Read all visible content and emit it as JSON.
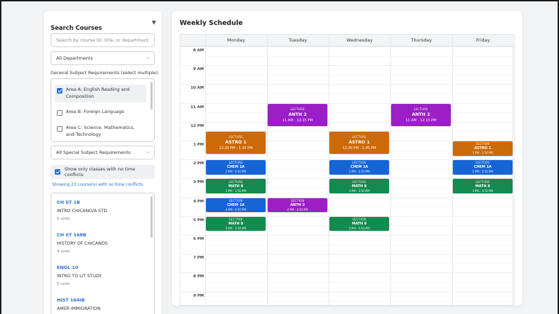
{
  "sidebar": {
    "title": "Search Courses",
    "search_placeholder": "Search by course ID, title, or department...",
    "department_select": "All Departments",
    "req_label": "General Subject Requirements (select multiple):",
    "requirements": [
      {
        "label": "Area A: English Reading and Composition",
        "checked": true
      },
      {
        "label": "Area B: Foreign Language",
        "checked": false
      },
      {
        "label": "Area C: Science, Mathematics, and Technology",
        "checked": false
      }
    ],
    "special_select": "All Special Subject Requirements",
    "no_conflict_label": "Show only classes with no time conflicts",
    "showing_text": "Showing 23 course(s) with no time conflicts",
    "courses": [
      {
        "id": "CH ST 1B",
        "title": "INTRO CHICANO/A STD",
        "units": "5 units"
      },
      {
        "id": "CH ST 168B",
        "title": "HISTORY OF CHICANOS",
        "units": "4 units"
      },
      {
        "id": "ENGL 10",
        "title": "INTRO TO LIT STUDY",
        "units": "5 units"
      },
      {
        "id": "HIST 164IB",
        "title": "AMER IMMIGRATION",
        "units": ""
      }
    ]
  },
  "schedule": {
    "title": "Weekly Schedule",
    "days": [
      "Monday",
      "Tuesday",
      "Wednesday",
      "Thursday",
      "Friday"
    ],
    "times": [
      "8 AM",
      "9 AM",
      "10 AM",
      "11 AM",
      "12 PM",
      "1 PM",
      "2 PM",
      "3 PM",
      "4 PM",
      "5 PM",
      "6 PM",
      "7 PM",
      "8 PM",
      "9 PM"
    ],
    "colors": {
      "orange": "#cc6a0a",
      "purple": "#9b1fc4",
      "blue": "#1565d6",
      "green": "#138a4e"
    },
    "events": [
      {
        "day": 1,
        "start": 11.0,
        "end": 12.25,
        "type": "LECTURE",
        "name": "ANTH 2",
        "time": "11 AM - 12:15 PM",
        "color": "purple",
        "size": "big"
      },
      {
        "day": 3,
        "start": 11.0,
        "end": 12.25,
        "type": "LECTURE",
        "name": "ANTH 2",
        "time": "11 AM - 12:15 PM",
        "color": "purple",
        "size": "big"
      },
      {
        "day": 0,
        "start": 12.5,
        "end": 13.75,
        "type": "LECTURE",
        "name": "ASTRO 1",
        "time": "12:30 PM - 1:45 PM",
        "color": "orange",
        "size": "big"
      },
      {
        "day": 2,
        "start": 12.5,
        "end": 13.75,
        "type": "LECTURE",
        "name": "ASTRO 1",
        "time": "12:30 PM - 1:45 PM",
        "color": "orange",
        "size": "big"
      },
      {
        "day": 4,
        "start": 13.0,
        "end": 13.83,
        "type": "SECTION",
        "name": "ASTRO 1",
        "time": "1 PM - 1:50 PM",
        "color": "orange",
        "size": "small"
      },
      {
        "day": 0,
        "start": 14.0,
        "end": 14.83,
        "type": "LECTURE",
        "name": "CHEM 1A",
        "time": "2 PM - 2:50 PM",
        "color": "blue",
        "size": "small"
      },
      {
        "day": 2,
        "start": 14.0,
        "end": 14.83,
        "type": "LECTURE",
        "name": "CHEM 1A",
        "time": "2 PM - 2:50 PM",
        "color": "blue",
        "size": "small"
      },
      {
        "day": 4,
        "start": 14.0,
        "end": 14.83,
        "type": "LECTURE",
        "name": "CHEM 1A",
        "time": "2 PM - 2:50 PM",
        "color": "blue",
        "size": "small"
      },
      {
        "day": 0,
        "start": 15.0,
        "end": 15.83,
        "type": "LECTURE",
        "name": "MATH 8",
        "time": "3 PM - 3:50 PM",
        "color": "green",
        "size": "small"
      },
      {
        "day": 2,
        "start": 15.0,
        "end": 15.83,
        "type": "LECTURE",
        "name": "MATH 8",
        "time": "3 PM - 3:50 PM",
        "color": "green",
        "size": "small"
      },
      {
        "day": 4,
        "start": 15.0,
        "end": 15.83,
        "type": "LECTURE",
        "name": "MATH 8",
        "time": "3 PM - 3:50 PM",
        "color": "green",
        "size": "small"
      },
      {
        "day": 0,
        "start": 16.0,
        "end": 16.83,
        "type": "SECTION",
        "name": "CHEM 1A",
        "time": "4 PM - 4:50 PM",
        "color": "blue",
        "size": "small"
      },
      {
        "day": 1,
        "start": 16.0,
        "end": 16.83,
        "type": "SECTION",
        "name": "ANTH 2",
        "time": "4 PM - 4:50 PM",
        "color": "purple",
        "size": "small"
      },
      {
        "day": 0,
        "start": 17.0,
        "end": 17.83,
        "type": "SECTION",
        "name": "MATH 8",
        "time": "5 PM - 5:50 PM",
        "color": "green",
        "size": "small"
      },
      {
        "day": 2,
        "start": 17.0,
        "end": 17.83,
        "type": "SECTION",
        "name": "MATH 8",
        "time": "5 PM - 5:50 PM",
        "color": "green",
        "size": "small"
      }
    ]
  }
}
